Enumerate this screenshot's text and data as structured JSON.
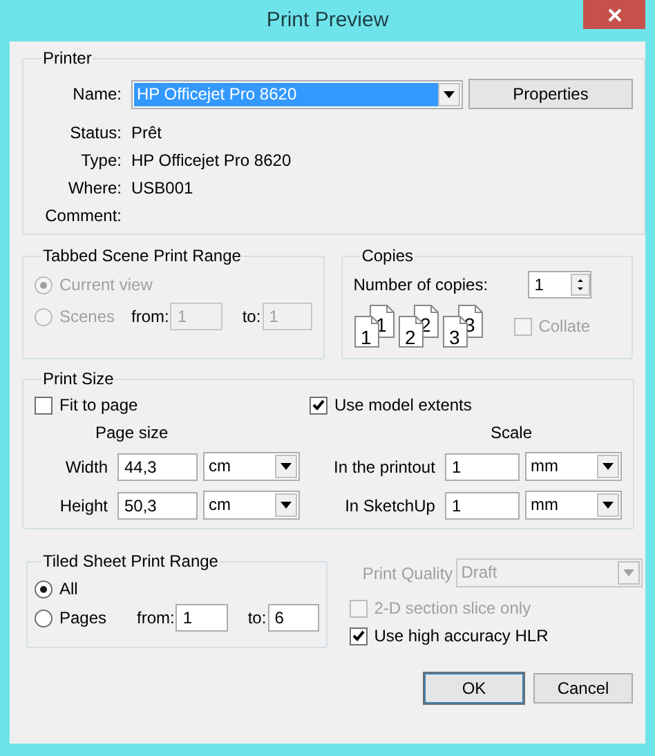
{
  "window": {
    "title": "Print Preview"
  },
  "printer": {
    "legend": "Printer",
    "name_label": "Name:",
    "name_value": "HP Officejet Pro 8620",
    "properties_button": "Properties",
    "info": [
      {
        "label": "Status:",
        "value": "Prêt"
      },
      {
        "label": "Type:",
        "value": "HP Officejet Pro 8620"
      },
      {
        "label": "Where:",
        "value": "USB001"
      },
      {
        "label": "Comment:"
      }
    ]
  },
  "tabbed_range": {
    "legend": "Tabbed Scene Print Range",
    "disabled": true,
    "options": [
      {
        "label": "Current view",
        "selected": true
      },
      {
        "label": "Scenes",
        "selected": false,
        "from_label": "from:",
        "from_value": "1",
        "to_label": "to:",
        "to_value": "1"
      }
    ]
  },
  "copies": {
    "legend": "Copies",
    "label": "Number of copies:",
    "value": "1",
    "sheets": [
      [
        "1",
        "1"
      ],
      [
        "2",
        "2"
      ],
      [
        "3",
        "3"
      ]
    ],
    "collate": {
      "label": "Collate",
      "checked": false,
      "disabled": true
    }
  },
  "print_size": {
    "legend": "Print Size",
    "fit_to_page": {
      "label": "Fit to page",
      "checked": false
    },
    "use_model_extents": {
      "label": "Use model extents",
      "checked": true
    },
    "page_size": {
      "heading": "Page size",
      "rows": [
        {
          "label": "Width",
          "value": "44,3",
          "unit": "cm"
        },
        {
          "label": "Height",
          "value": "50,3",
          "unit": "cm"
        }
      ]
    },
    "scale": {
      "heading": "Scale",
      "rows": [
        {
          "label": "In the printout",
          "value": "1",
          "unit": "mm"
        },
        {
          "label": "In SketchUp",
          "value": "1",
          "unit": "mm"
        }
      ]
    }
  },
  "tiled_range": {
    "legend": "Tiled Sheet Print Range",
    "options": [
      {
        "label": "All",
        "selected": true
      },
      {
        "label": "Pages",
        "selected": false,
        "from_label": "from:",
        "from_value": "1",
        "to_label": "to:",
        "to_value": "6"
      }
    ]
  },
  "print_quality": {
    "label": "Print Quality",
    "value": "Draft",
    "disabled": true
  },
  "options": [
    {
      "label": "2-D section slice only",
      "checked": false,
      "disabled": true
    },
    {
      "label": "Use high accuracy HLR",
      "checked": true,
      "disabled": false
    }
  ],
  "buttons": [
    {
      "label": "OK",
      "default": true
    },
    {
      "label": "Cancel",
      "default": false
    }
  ]
}
